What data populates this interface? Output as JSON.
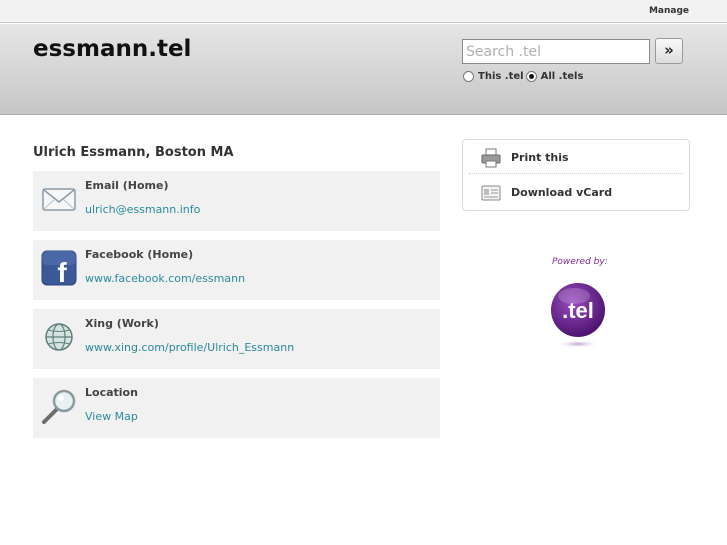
{
  "topbar": {
    "manage_label": "Manage"
  },
  "header": {
    "site_title": "essmann.tel",
    "search": {
      "placeholder": "Search .tel",
      "button_label": "»"
    },
    "scope": {
      "option_this": "This .tel",
      "option_all": "All .tels",
      "selected": "All .tels"
    }
  },
  "profile": {
    "name": "Ulrich Essmann, Boston MA"
  },
  "contacts": [
    {
      "label": "Email (Home)",
      "value": "ulrich@essmann.info",
      "icon": "envelope-icon"
    },
    {
      "label": "Facebook (Home)",
      "value": "www.facebook.com/essmann",
      "icon": "facebook-icon"
    },
    {
      "label": "Xing (Work)",
      "value": "www.xing.com/profile/Ulrich_Essmann",
      "icon": "globe-icon"
    },
    {
      "label": "Location",
      "value": "View Map",
      "icon": "magnifier-icon"
    }
  ],
  "sidebar": {
    "print_label": "Print this",
    "vcard_label": "Download vCard",
    "powered_by": "Powered by:",
    "logo_text": ".tel"
  },
  "colors": {
    "link": "#2a8a9a",
    "powered_by": "#7a2e9a",
    "logo": "#6a2590"
  }
}
